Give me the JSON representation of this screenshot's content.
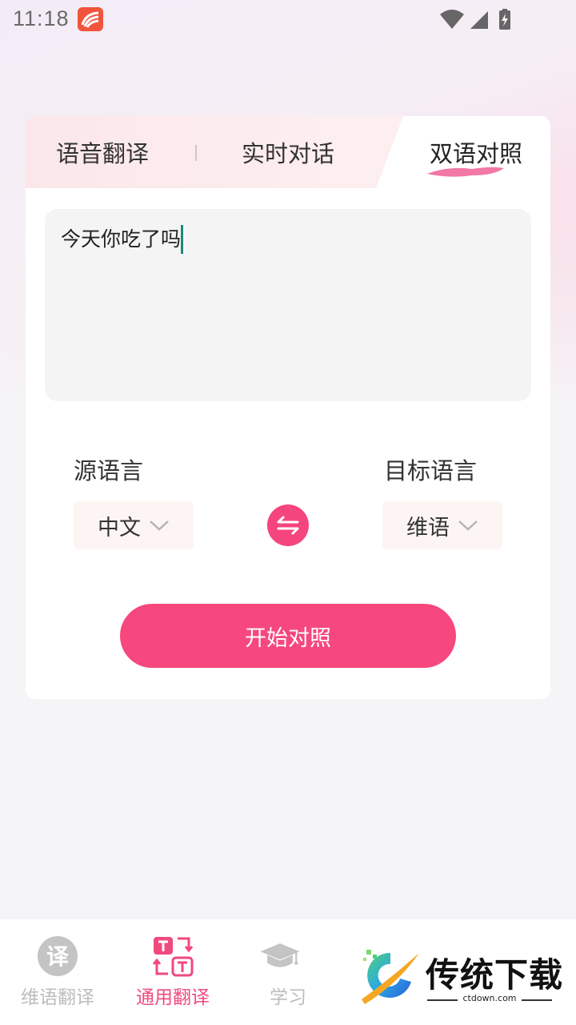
{
  "status_bar": {
    "time": "11:18"
  },
  "tabs": {
    "items": [
      {
        "label": "语音翻译"
      },
      {
        "label": "实时对话"
      },
      {
        "label": "双语对照"
      }
    ],
    "active_index": 2
  },
  "input": {
    "value": "今天你吃了吗"
  },
  "languages": {
    "source_label": "源语言",
    "source_value": "中文",
    "target_label": "目标语言",
    "target_value": "维语"
  },
  "start_button": {
    "label": "开始对照"
  },
  "bottom_nav": {
    "items": [
      {
        "label": "维语翻译",
        "icon": "translate-char-icon",
        "icon_char": "译"
      },
      {
        "label": "通用翻译",
        "icon": "text-swap-icon"
      },
      {
        "label": "学习",
        "icon": "graduation-cap-icon"
      }
    ],
    "active_index": 1
  },
  "watermark": {
    "title": "传统下载",
    "site": "ctdown.com"
  },
  "colors": {
    "accent": "#f6477f",
    "caret": "#1e8a78",
    "inactive_nav": "#bdbdbd"
  }
}
